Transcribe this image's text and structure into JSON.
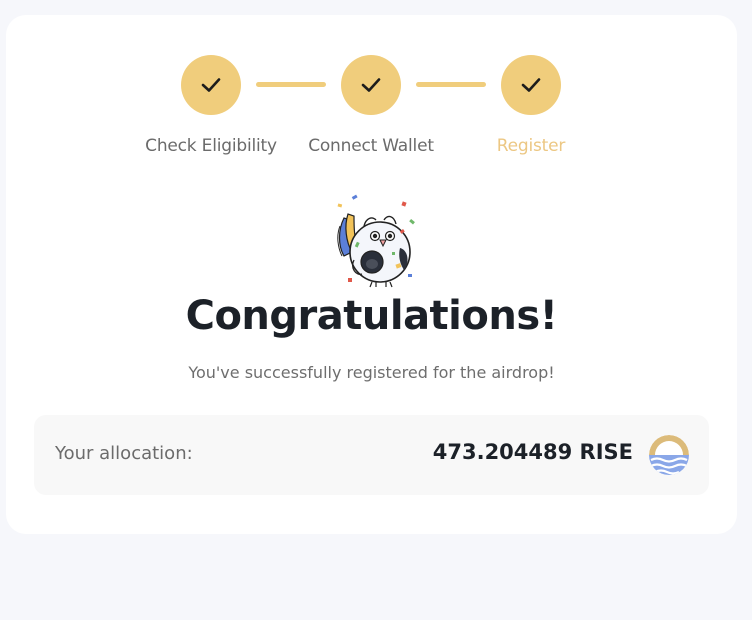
{
  "stepper": {
    "steps": [
      {
        "label": "Check Eligibility",
        "status": "complete"
      },
      {
        "label": "Connect Wallet",
        "status": "complete"
      },
      {
        "label": "Register",
        "status": "complete-current"
      }
    ],
    "accent_color": "#f0cd7c",
    "active_label_color": "#ecc783",
    "icon": "check-icon"
  },
  "hero": {
    "mascot_icon": "celebrating-bird-mascot",
    "title": "Congratulations!",
    "subtitle": "You've successfully registered for the airdrop!"
  },
  "allocation": {
    "label": "Your allocation:",
    "value": "473.204489 RISE",
    "token_icon": "rise-token-icon"
  }
}
